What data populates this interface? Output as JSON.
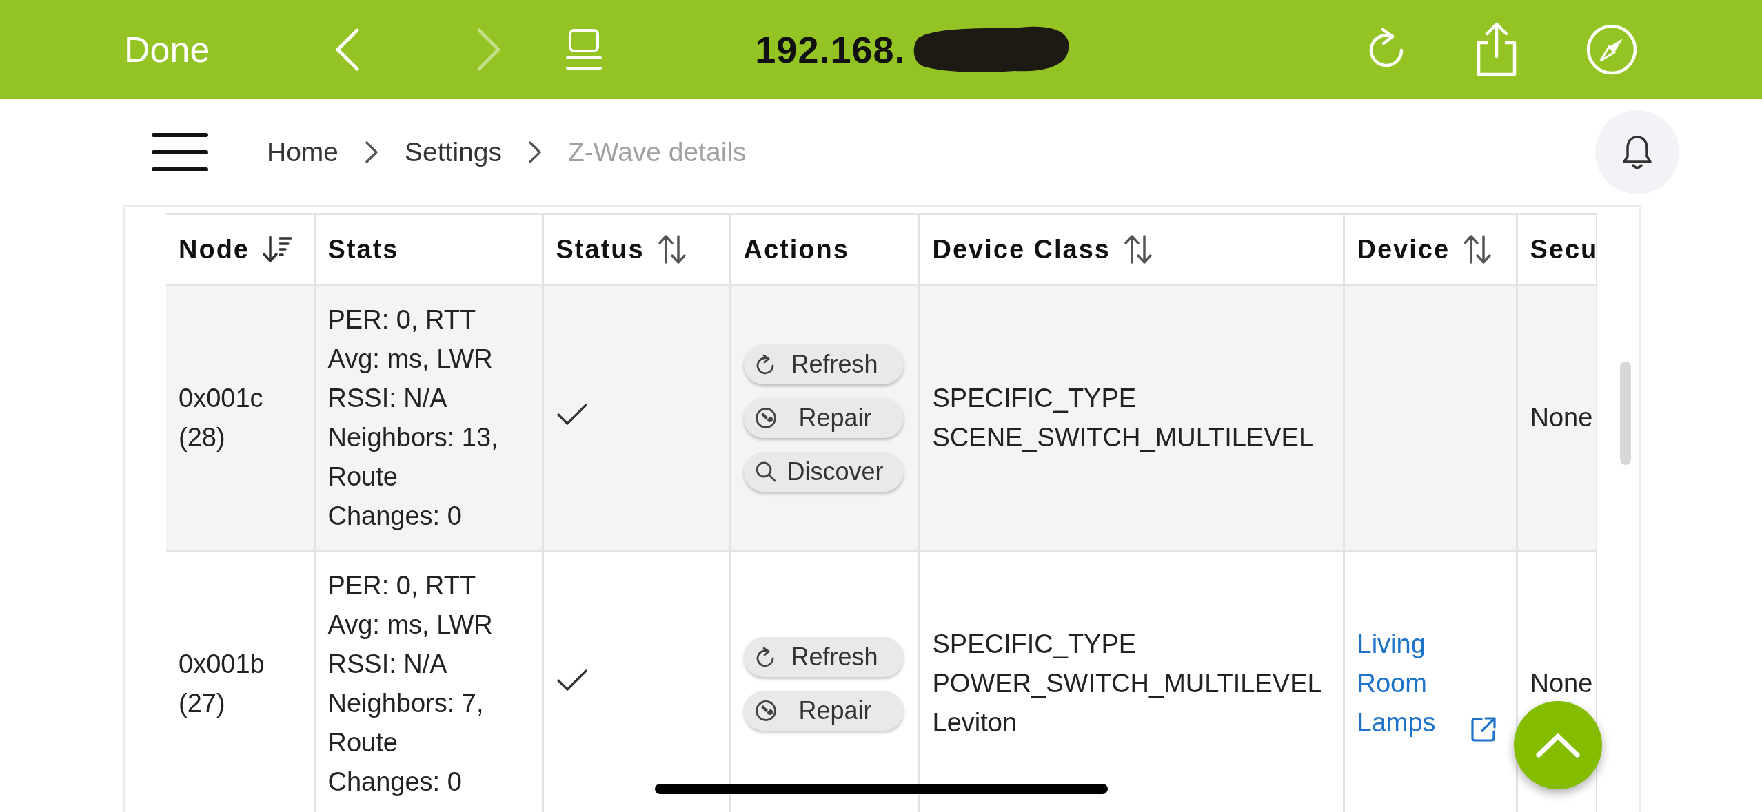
{
  "browser_bar": {
    "done": "Done",
    "address": "192.168.",
    "nav": [
      {
        "kind": "back",
        "disabled": false
      },
      {
        "kind": "forward",
        "disabled": true
      },
      {
        "kind": "tabs",
        "disabled": false
      }
    ],
    "actions": [
      {
        "kind": "reload"
      },
      {
        "kind": "share"
      },
      {
        "kind": "compass"
      }
    ]
  },
  "header": {
    "breadcrumbs": [
      {
        "label": "Home",
        "current": false
      },
      {
        "label": "Settings",
        "current": false
      },
      {
        "label": "Z-Wave details",
        "current": true
      }
    ]
  },
  "table": {
    "columns": [
      {
        "label": "Node",
        "sortable": true,
        "sorted_descending": true
      },
      {
        "label": "Stats",
        "sortable": false,
        "sorted_descending": false
      },
      {
        "label": "Status",
        "sortable": true,
        "sorted_descending": false
      },
      {
        "label": "Actions",
        "sortable": false,
        "sorted_descending": false
      },
      {
        "label": "Device Class",
        "sortable": true,
        "sorted_descending": false
      },
      {
        "label": "Device",
        "sortable": true,
        "sorted_descending": false
      },
      {
        "label": "Secu"
      }
    ],
    "rows": [
      {
        "node": "0x001c (28)",
        "stats": "PER: 0, RTT Avg: ms, LWR RSSI: N/A Neighbors: 13, Route Changes: 0",
        "online": true,
        "actions": [
          {
            "kind": "refresh",
            "label": "Refresh"
          },
          {
            "kind": "repair",
            "label": "Repair"
          },
          {
            "kind": "discover",
            "label": "Discover"
          }
        ],
        "device_class": "SPECIFIC_TYPE SCENE_SWITCH_MULTILEVEL",
        "security": "None"
      },
      {
        "node": "0x001b (27)",
        "stats": "PER: 0, RTT Avg: ms, LWR RSSI: N/A Neighbors: 7, Route Changes: 0",
        "online": true,
        "actions": [
          {
            "kind": "refresh",
            "label": "Refresh"
          },
          {
            "kind": "repair",
            "label": "Repair"
          }
        ],
        "device_class": "SPECIFIC_TYPE POWER_SWITCH_MULTILEVEL Leviton",
        "device": {
          "label": "Living Room Lamps",
          "external": true
        },
        "security": "None"
      }
    ]
  }
}
